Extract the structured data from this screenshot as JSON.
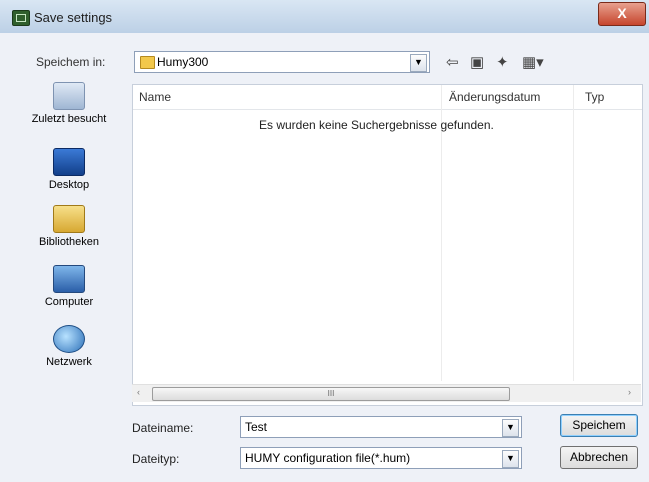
{
  "window": {
    "title": "Save settings",
    "close_label": "X"
  },
  "toolbar": {
    "look_in_label": "Speichem in:",
    "look_in_value": "Humy300",
    "icons": [
      "back-arrow-icon",
      "up-folder-icon",
      "new-folder-icon",
      "view-menu-icon"
    ]
  },
  "places": [
    {
      "label": "Zuletzt besucht",
      "icon": "recent-places-icon"
    },
    {
      "label": "Desktop",
      "icon": "desktop-icon"
    },
    {
      "label": "Bibliotheken",
      "icon": "libraries-icon"
    },
    {
      "label": "Computer",
      "icon": "computer-icon"
    },
    {
      "label": "Netzwerk",
      "icon": "network-icon"
    }
  ],
  "list": {
    "columns": [
      "Name",
      "Änderungsdatum",
      "Typ"
    ],
    "empty_message": "Es wurden keine Suchergebnisse gefunden."
  },
  "form": {
    "filename_label": "Dateiname:",
    "filename_value": "Test",
    "filetype_label": "Dateityp:",
    "filetype_value": "HUMY configuration file(*.hum)"
  },
  "buttons": {
    "save": "Speichem",
    "cancel": "Abbrechen"
  },
  "scrollbar": {
    "thumb_grip": "III",
    "left_arrow": "‹",
    "right_arrow": "›"
  }
}
